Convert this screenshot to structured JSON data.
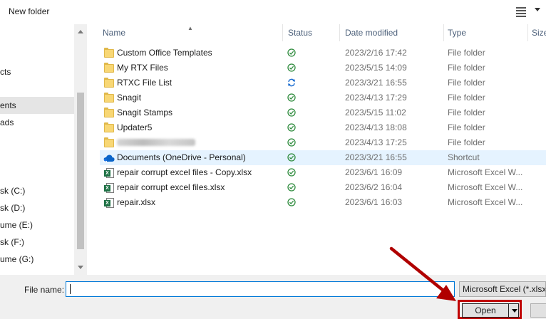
{
  "toolbar": {
    "new_folder": "New folder"
  },
  "nav": {
    "items": [
      {
        "label": "cts",
        "selected": false
      },
      {
        "label": "ents",
        "selected": true
      },
      {
        "label": "ads",
        "selected": false
      },
      {
        "label": "sk (C:)",
        "selected": false
      },
      {
        "label": "sk (D:)",
        "selected": false
      },
      {
        "label": "ume (E:)",
        "selected": false
      },
      {
        "label": "sk (F:)",
        "selected": false
      },
      {
        "label": "ume (G:)",
        "selected": false
      }
    ]
  },
  "columns": {
    "name": "Name",
    "status": "Status",
    "date": "Date modified",
    "type": "Type",
    "size": "Size"
  },
  "files": [
    {
      "name": "Custom Office Templates",
      "icon": "folder-icon",
      "status": "synced",
      "date": "2023/2/16 17:42",
      "type": "File folder"
    },
    {
      "name": "My RTX Files",
      "icon": "folder-icon",
      "status": "synced",
      "date": "2023/5/15 14:09",
      "type": "File folder"
    },
    {
      "name": "RTXC File List",
      "icon": "folder-icon",
      "status": "syncing",
      "date": "2023/3/21 16:55",
      "type": "File folder"
    },
    {
      "name": "Snagit",
      "icon": "folder-icon",
      "status": "synced",
      "date": "2023/4/13 17:29",
      "type": "File folder"
    },
    {
      "name": "Snagit Stamps",
      "icon": "folder-icon",
      "status": "synced",
      "date": "2023/5/15 11:02",
      "type": "File folder"
    },
    {
      "name": "Updater5",
      "icon": "folder-icon",
      "status": "synced",
      "date": "2023/4/13 18:08",
      "type": "File folder"
    },
    {
      "name": "",
      "icon": "blurred",
      "status": "synced",
      "date": "2023/4/13 17:25",
      "type": "File folder"
    },
    {
      "name": "Documents (OneDrive - Personal)",
      "icon": "onedrive-icon",
      "status": "synced",
      "date": "2023/3/21 16:55",
      "type": "Shortcut",
      "selected": true
    },
    {
      "name": "repair corrupt excel files - Copy.xlsx",
      "icon": "excel-icon",
      "status": "synced",
      "date": "2023/6/1 16:09",
      "type": "Microsoft Excel W..."
    },
    {
      "name": "repair corrupt excel files.xlsx",
      "icon": "excel-icon",
      "status": "synced",
      "date": "2023/6/2 16:04",
      "type": "Microsoft Excel W..."
    },
    {
      "name": "repair.xlsx",
      "icon": "excel-icon",
      "status": "synced",
      "date": "2023/6/1 16:03",
      "type": "Microsoft Excel W..."
    }
  ],
  "bottom": {
    "file_name_label": "File name:",
    "file_name_value": "",
    "filter": "Microsoft Excel (*.xlsx)",
    "open_label": "Open"
  },
  "colors": {
    "accent": "#0078d7",
    "annotation": "#c00000",
    "synced": "#2e8b3d",
    "syncing": "#1f6fd1",
    "selected_row": "#e5f3ff"
  }
}
